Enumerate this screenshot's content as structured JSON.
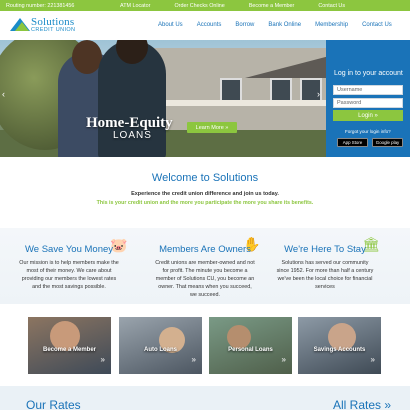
{
  "topbar": {
    "routing": "Routing number: 221381456",
    "links": [
      "ATM Locator",
      "Order Checks Online",
      "Become a Member",
      "Contact Us"
    ]
  },
  "brand": {
    "name": "Solutions",
    "sub": "CREDIT UNION",
    "color": "#1a8bc8"
  },
  "nav": [
    "About Us",
    "Accounts",
    "Borrow",
    "Bank Online",
    "Membership",
    "Contact Us"
  ],
  "hero": {
    "title": "Home-Equity",
    "subtitle": "LOANS",
    "cta": "Learn More »",
    "prev_icon": "‹",
    "next_icon": "›"
  },
  "login": {
    "title": "Log in to your account",
    "username_placeholder": "Username",
    "password_placeholder": "Password",
    "button": "Login »",
    "forgot": "Forgot your login info?",
    "app_store": "App Store",
    "google_play": "Google play"
  },
  "welcome": {
    "title": "Welcome to Solutions",
    "line1": "Experience the credit union difference and join us today.",
    "line2": "This is your credit union and the more you participate the more you share its benefits."
  },
  "features": [
    {
      "title": "We Save You Money",
      "icon": "piggy-bank-icon",
      "text": "Our mission is to help members make the most of their money. We care about providing our members the lowest rates and the most savings possible."
    },
    {
      "title": "Members Are Owners",
      "icon": "hand-coin-icon",
      "text": "Credit unions are member-owned and not for profit. The minute you become a member of Solutions CU, you become an owner. That means when you succeed, we succeed."
    },
    {
      "title": "We're Here To Stay",
      "icon": "bank-building-icon",
      "text": "Solutions has served our community since 1952. For more than half a century we've been the local choice for financial services"
    }
  ],
  "tiles": [
    "Become a Member",
    "Auto Loans",
    "Personal Loans",
    "Savings Accounts"
  ],
  "footer": {
    "rates": "Our Rates",
    "all_rates": "All Rates »"
  },
  "colors": {
    "green": "#8cc63f",
    "blue": "#1a73b8"
  }
}
